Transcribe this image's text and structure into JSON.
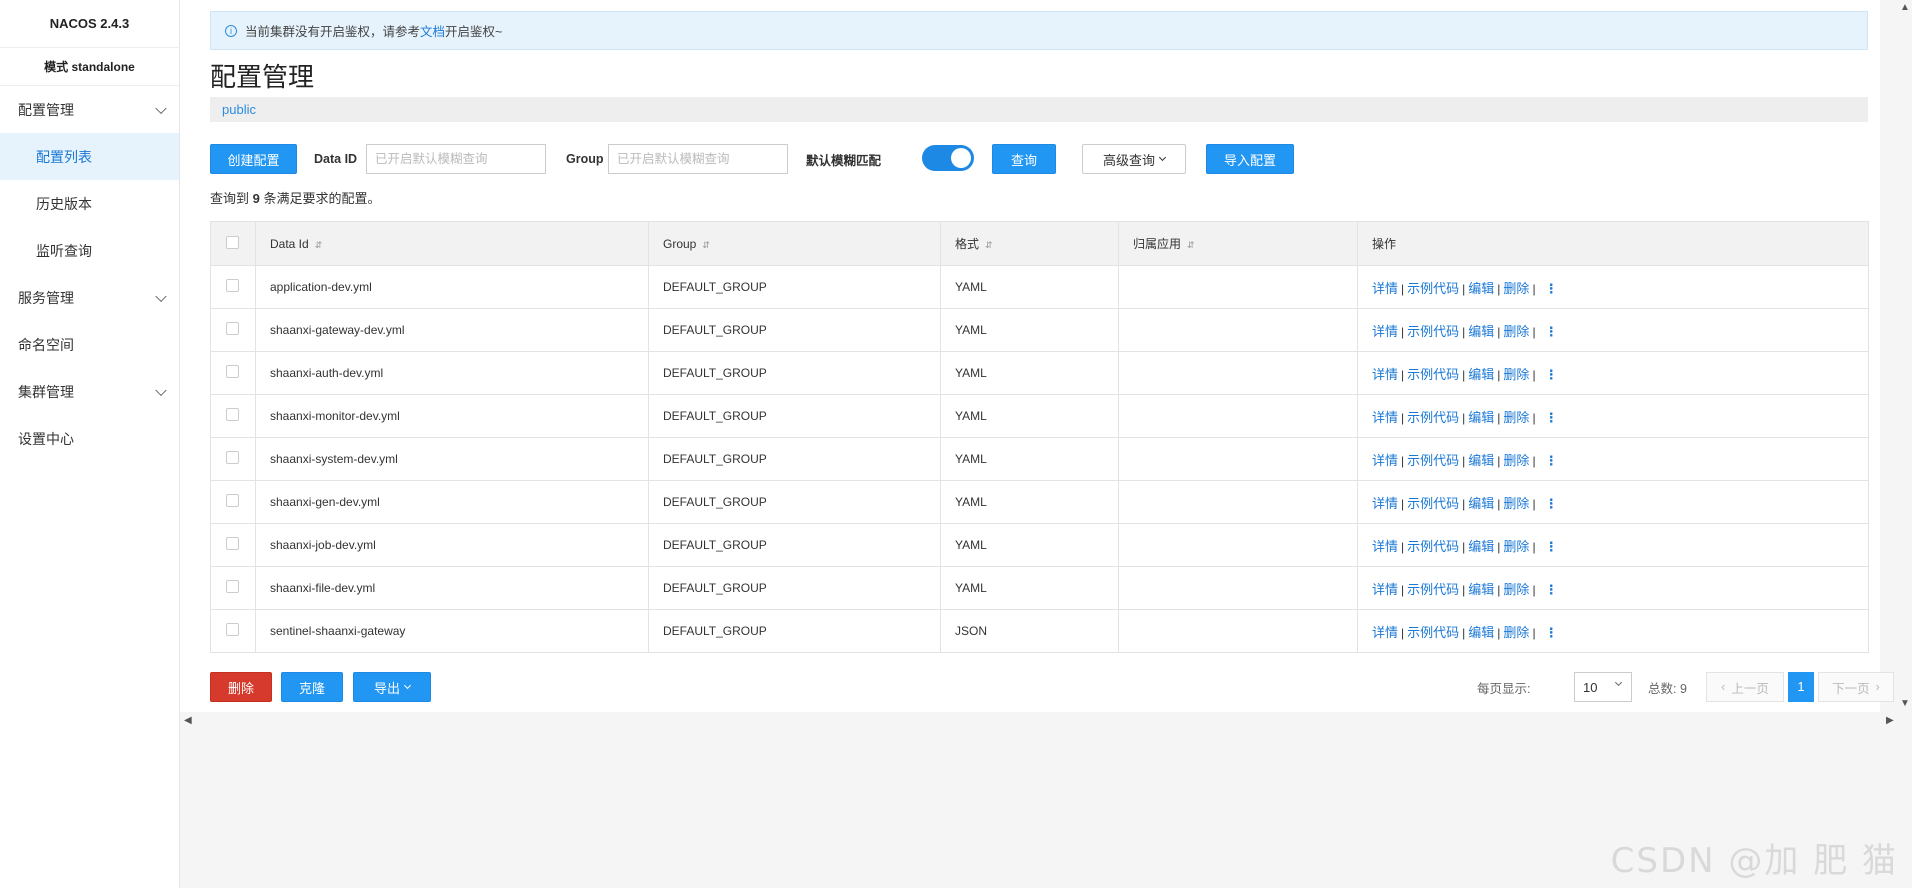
{
  "sidebar": {
    "brand": "NACOS 2.4.3",
    "mode": "模式 standalone",
    "items": [
      {
        "label": "配置管理"
      },
      {
        "label": "配置列表"
      },
      {
        "label": "历史版本"
      },
      {
        "label": "监听查询"
      },
      {
        "label": "服务管理"
      },
      {
        "label": "命名空间"
      },
      {
        "label": "集群管理"
      },
      {
        "label": "设置中心"
      }
    ]
  },
  "alert": {
    "prefix": "当前集群没有开启鉴权，请参考",
    "link": "文档",
    "suffix": "开启鉴权~"
  },
  "page": {
    "title": "配置管理",
    "namespace": "public"
  },
  "toolbar": {
    "create_label": "创建配置",
    "dataid_label": "Data ID",
    "dataid_placeholder": "已开启默认模糊查询",
    "group_label": "Group",
    "group_placeholder": "已开启默认模糊查询",
    "fuzzy_label": "默认模糊匹配",
    "fuzzy_on": true,
    "search_label": "查询",
    "advanced_label": "高级查询",
    "import_label": "导入配置"
  },
  "result": {
    "prefix": "查询到",
    "count": "9",
    "suffix": "条满足要求的配置。"
  },
  "table": {
    "headers": {
      "data_id": "Data Id",
      "group": "Group",
      "format": "格式",
      "app": "归属应用",
      "ops": "操作"
    },
    "sort_icon": "⇵",
    "ops": {
      "detail": "详情",
      "sample": "示例代码",
      "edit": "编辑",
      "delete": "删除",
      "sep": "|",
      "more": "⋮"
    },
    "rows": [
      {
        "data_id": "application-dev.yml",
        "group": "DEFAULT_GROUP",
        "format": "YAML",
        "app": ""
      },
      {
        "data_id": "shaanxi-gateway-dev.yml",
        "group": "DEFAULT_GROUP",
        "format": "YAML",
        "app": ""
      },
      {
        "data_id": "shaanxi-auth-dev.yml",
        "group": "DEFAULT_GROUP",
        "format": "YAML",
        "app": ""
      },
      {
        "data_id": "shaanxi-monitor-dev.yml",
        "group": "DEFAULT_GROUP",
        "format": "YAML",
        "app": ""
      },
      {
        "data_id": "shaanxi-system-dev.yml",
        "group": "DEFAULT_GROUP",
        "format": "YAML",
        "app": ""
      },
      {
        "data_id": "shaanxi-gen-dev.yml",
        "group": "DEFAULT_GROUP",
        "format": "YAML",
        "app": ""
      },
      {
        "data_id": "shaanxi-job-dev.yml",
        "group": "DEFAULT_GROUP",
        "format": "YAML",
        "app": ""
      },
      {
        "data_id": "shaanxi-file-dev.yml",
        "group": "DEFAULT_GROUP",
        "format": "YAML",
        "app": ""
      },
      {
        "data_id": "sentinel-shaanxi-gateway",
        "group": "DEFAULT_GROUP",
        "format": "JSON",
        "app": ""
      }
    ]
  },
  "footer": {
    "delete_label": "删除",
    "clone_label": "克隆",
    "export_label": "导出",
    "page_size_label": "每页显示:",
    "page_size": "10",
    "total_label": "总数: 9",
    "prev_label": "上一页",
    "current_page": "1",
    "next_label": "下一页"
  },
  "watermark": "CSDN @加 肥 猫",
  "colors": {
    "primary": "#2196f3",
    "danger": "#d63a2c",
    "link": "#1a78d6"
  }
}
